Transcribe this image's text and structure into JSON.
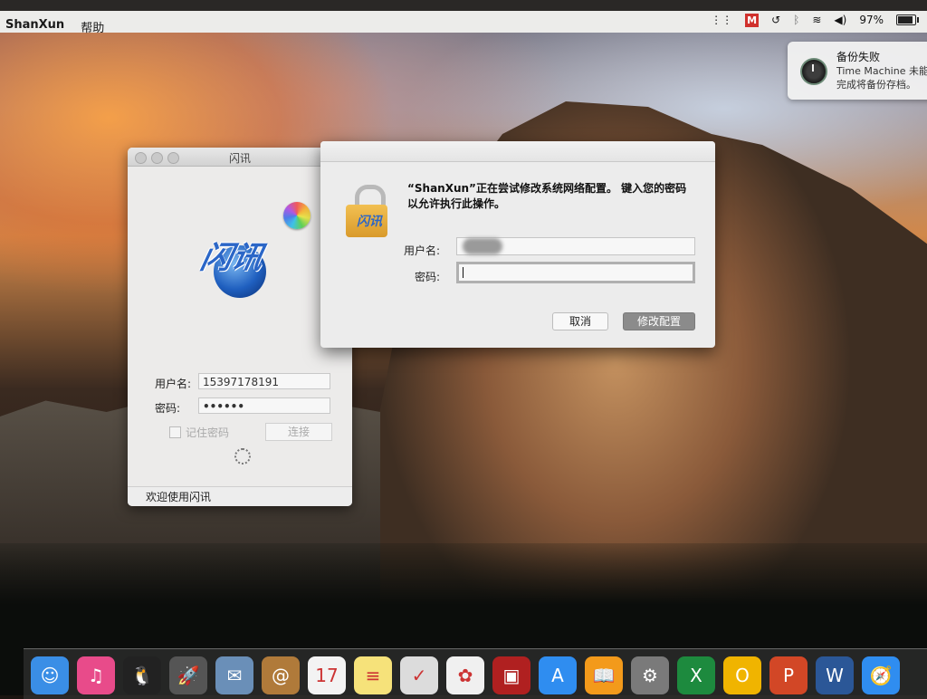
{
  "menubar": {
    "app_name": "ShanXun",
    "menu_help": "帮助",
    "battery_percent": "97%",
    "battery_level": 0.97,
    "m_badge": "M"
  },
  "notification": {
    "title": "备份失败",
    "body": "Time Machine 未能完成将备份存档。",
    "icon": "time-machine-icon"
  },
  "shanxun_window": {
    "title": "闪讯",
    "logo_text": "闪讯",
    "username_label": "用户名:",
    "username_value": "15397178191",
    "password_label": "密码:",
    "password_value": "••••••",
    "remember_label": "记住密码",
    "connect_label": "连接",
    "status_text": "欢迎使用闪讯"
  },
  "auth_dialog": {
    "message": "“ShanXun”正在尝试修改系统网络配置。 键入您的密码以允许执行此操作。",
    "username_label": "用户名:",
    "password_label": "密码:",
    "cancel_label": "取消",
    "confirm_label": "修改配置",
    "lock_logo_text": "闪讯"
  },
  "dock": {
    "items": [
      {
        "name": "finder",
        "color": "#3a8ee6",
        "glyph": "☺"
      },
      {
        "name": "itunes",
        "color": "#e84b8a",
        "glyph": "♫"
      },
      {
        "name": "qq",
        "color": "#222222",
        "glyph": "🐧"
      },
      {
        "name": "launchpad",
        "color": "#555555",
        "glyph": "🚀"
      },
      {
        "name": "preview",
        "color": "#6a8fb8",
        "glyph": "✉"
      },
      {
        "name": "contacts",
        "color": "#b07a3a",
        "glyph": "@"
      },
      {
        "name": "calendar",
        "color": "#f3f3f3",
        "glyph": "17"
      },
      {
        "name": "notes",
        "color": "#f6e27a",
        "glyph": "≡"
      },
      {
        "name": "reminders",
        "color": "#dcdcdc",
        "glyph": "✓"
      },
      {
        "name": "photos",
        "color": "#f0f0f0",
        "glyph": "✿"
      },
      {
        "name": "photo-booth",
        "color": "#b02020",
        "glyph": "▣"
      },
      {
        "name": "app-store",
        "color": "#2f8df0",
        "glyph": "A"
      },
      {
        "name": "ibooks",
        "color": "#f39a1b",
        "glyph": "📖"
      },
      {
        "name": "system-preferences",
        "color": "#7a7a7a",
        "glyph": "⚙"
      },
      {
        "name": "excel",
        "color": "#1d8a3e",
        "glyph": "X"
      },
      {
        "name": "outlook",
        "color": "#f0b400",
        "glyph": "O"
      },
      {
        "name": "powerpoint",
        "color": "#d24726",
        "glyph": "P"
      },
      {
        "name": "word",
        "color": "#2b5797",
        "glyph": "W"
      },
      {
        "name": "safari",
        "color": "#2f8df0",
        "glyph": "🧭"
      }
    ]
  }
}
